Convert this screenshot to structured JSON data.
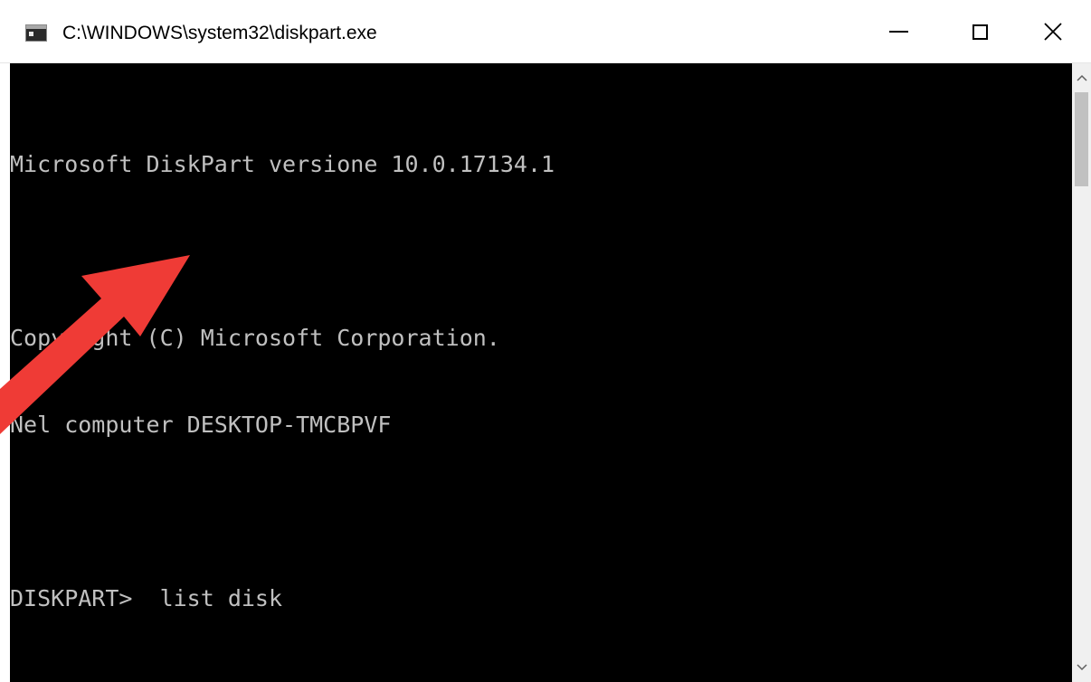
{
  "window": {
    "title": "C:\\WINDOWS\\system32\\diskpart.exe"
  },
  "console": {
    "lines": [
      "Microsoft DiskPart versione 10.0.17134.1",
      "",
      "Copyright (C) Microsoft Corporation.",
      "Nel computer DESKTOP-TMCBPVF",
      ""
    ],
    "prompt": "DISKPART>",
    "command": "list disk"
  },
  "icons": {
    "app": "console-app-icon",
    "minimize": "minimize-icon",
    "maximize": "maximize-icon",
    "close": "close-icon",
    "scroll_up": "chevron-up-icon",
    "scroll_down": "chevron-down-icon",
    "annotation": "arrow-annotation-icon"
  },
  "colors": {
    "console_background": "#000000",
    "console_text": "#c0c0c0",
    "annotation_arrow": "#ef3b36"
  }
}
